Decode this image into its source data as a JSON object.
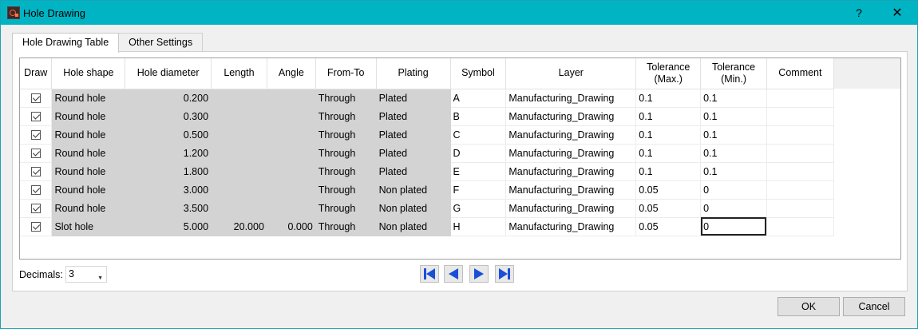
{
  "window": {
    "title": "Hole Drawing",
    "help_label": "?",
    "close_label": "✕"
  },
  "tabs": [
    {
      "label": "Hole Drawing Table",
      "active": true
    },
    {
      "label": "Other Settings",
      "active": false
    }
  ],
  "table": {
    "headers": [
      "Draw",
      "Hole shape",
      "Hole diameter",
      "Length",
      "Angle",
      "From-To",
      "Plating",
      "Symbol",
      "Layer",
      "Tolerance (Max.)",
      "Tolerance (Min.)",
      "Comment"
    ],
    "rows": [
      {
        "draw": true,
        "shape": "Round hole",
        "diameter": "0.200",
        "length": "",
        "angle": "",
        "from_to": "Through",
        "plating": "Plated",
        "symbol": "A",
        "layer": "Manufacturing_Drawing",
        "tol_max": "0.1",
        "tol_min": "0.1",
        "comment": ""
      },
      {
        "draw": true,
        "shape": "Round hole",
        "diameter": "0.300",
        "length": "",
        "angle": "",
        "from_to": "Through",
        "plating": "Plated",
        "symbol": "B",
        "layer": "Manufacturing_Drawing",
        "tol_max": "0.1",
        "tol_min": "0.1",
        "comment": ""
      },
      {
        "draw": true,
        "shape": "Round hole",
        "diameter": "0.500",
        "length": "",
        "angle": "",
        "from_to": "Through",
        "plating": "Plated",
        "symbol": "C",
        "layer": "Manufacturing_Drawing",
        "tol_max": "0.1",
        "tol_min": "0.1",
        "comment": ""
      },
      {
        "draw": true,
        "shape": "Round hole",
        "diameter": "1.200",
        "length": "",
        "angle": "",
        "from_to": "Through",
        "plating": "Plated",
        "symbol": "D",
        "layer": "Manufacturing_Drawing",
        "tol_max": "0.1",
        "tol_min": "0.1",
        "comment": ""
      },
      {
        "draw": true,
        "shape": "Round hole",
        "diameter": "1.800",
        "length": "",
        "angle": "",
        "from_to": "Through",
        "plating": "Plated",
        "symbol": "E",
        "layer": "Manufacturing_Drawing",
        "tol_max": "0.1",
        "tol_min": "0.1",
        "comment": ""
      },
      {
        "draw": true,
        "shape": "Round hole",
        "diameter": "3.000",
        "length": "",
        "angle": "",
        "from_to": "Through",
        "plating": "Non plated",
        "symbol": "F",
        "layer": "Manufacturing_Drawing",
        "tol_max": "0.05",
        "tol_min": "0",
        "comment": ""
      },
      {
        "draw": true,
        "shape": "Round hole",
        "diameter": "3.500",
        "length": "",
        "angle": "",
        "from_to": "Through",
        "plating": "Non plated",
        "symbol": "G",
        "layer": "Manufacturing_Drawing",
        "tol_max": "0.05",
        "tol_min": "0",
        "comment": ""
      },
      {
        "draw": true,
        "shape": "Slot hole",
        "diameter": "5.000",
        "length": "20.000",
        "angle": "0.000",
        "from_to": "Through",
        "plating": "Non plated",
        "symbol": "H",
        "layer": "Manufacturing_Drawing",
        "tol_max": "0.05",
        "tol_min": "0",
        "comment": ""
      }
    ]
  },
  "decimals": {
    "label": "Decimals:",
    "value": "3"
  },
  "navigation": {
    "icons": [
      "first-page-icon",
      "previous-page-icon",
      "next-page-icon",
      "last-page-icon"
    ],
    "color": "#1a4fd6"
  },
  "buttons": {
    "ok": "OK",
    "cancel": "Cancel"
  },
  "colors": {
    "titlebar": "#00b4c4",
    "readonly_cell": "#d3d3d3"
  }
}
